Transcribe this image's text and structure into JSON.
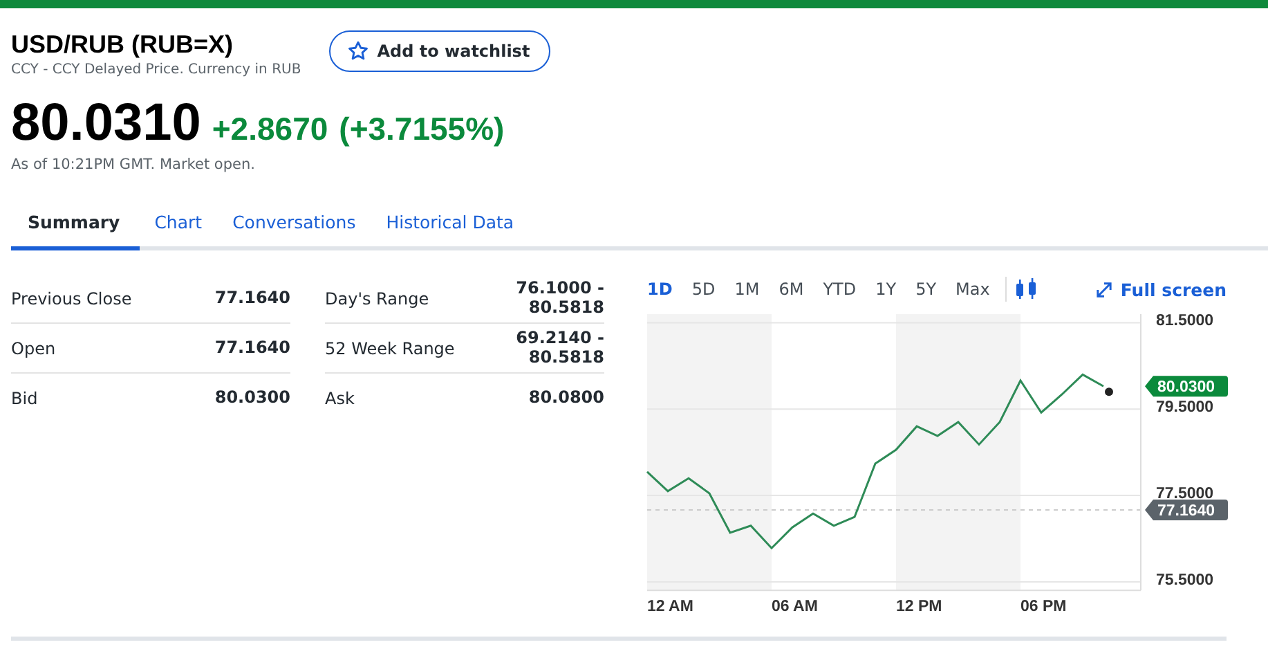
{
  "header": {
    "title": "USD/RUB (RUB=X)",
    "subtitle": "CCY - CCY Delayed Price. Currency in RUB",
    "watchlist_button": "Add to watchlist"
  },
  "quote": {
    "price": "80.0310",
    "change": "+2.8670",
    "change_percent": "(+3.7155%)",
    "as_of": "As of 10:21PM GMT. Market open."
  },
  "tabs": [
    {
      "label": "Summary",
      "selected": true
    },
    {
      "label": "Chart",
      "selected": false
    },
    {
      "label": "Conversations",
      "selected": false
    },
    {
      "label": "Historical Data",
      "selected": false
    }
  ],
  "stats": [
    {
      "label": "Previous Close",
      "value": "77.1640"
    },
    {
      "label": "Day's Range",
      "value": "76.1000 - 80.5818"
    },
    {
      "label": "Open",
      "value": "77.1640"
    },
    {
      "label": "52 Week Range",
      "value": "69.2140 - 80.5818"
    },
    {
      "label": "Bid",
      "value": "80.0300"
    },
    {
      "label": "Ask",
      "value": "80.0800"
    }
  ],
  "ranges": [
    {
      "label": "1D",
      "selected": true
    },
    {
      "label": "5D",
      "selected": false
    },
    {
      "label": "1M",
      "selected": false
    },
    {
      "label": "6M",
      "selected": false
    },
    {
      "label": "YTD",
      "selected": false
    },
    {
      "label": "1Y",
      "selected": false
    },
    {
      "label": "5Y",
      "selected": false
    },
    {
      "label": "Max",
      "selected": false
    }
  ],
  "full_screen": "Full screen",
  "chart": {
    "current_tag": "80.0300",
    "prev_close_tag": "77.1640",
    "time_labels": [
      "12 AM",
      "06 AM",
      "12 PM",
      "06 PM"
    ],
    "chart_data": {
      "type": "line",
      "grid": true,
      "series": [
        {
          "color": "#2e8b57",
          "values": [
            78.05,
            77.6,
            77.9,
            77.55,
            76.64,
            76.8,
            76.28,
            76.76,
            77.08,
            76.8,
            77.0,
            78.24,
            78.56,
            79.1,
            78.88,
            79.2,
            78.68,
            79.2,
            80.16,
            79.42,
            79.84,
            80.3,
            80.03
          ]
        }
      ],
      "ylim": [
        75.3,
        81.7
      ],
      "ref_lines": [
        {
          "axis": "y",
          "value": 77.164
        }
      ],
      "yticks": [
        {
          "value": 81.5,
          "label": "81.5000"
        },
        {
          "value": 79.5,
          "label": "79.5000"
        },
        {
          "value": 77.5,
          "label": "77.5000"
        },
        {
          "value": 75.5,
          "label": "75.5000"
        }
      ]
    }
  }
}
